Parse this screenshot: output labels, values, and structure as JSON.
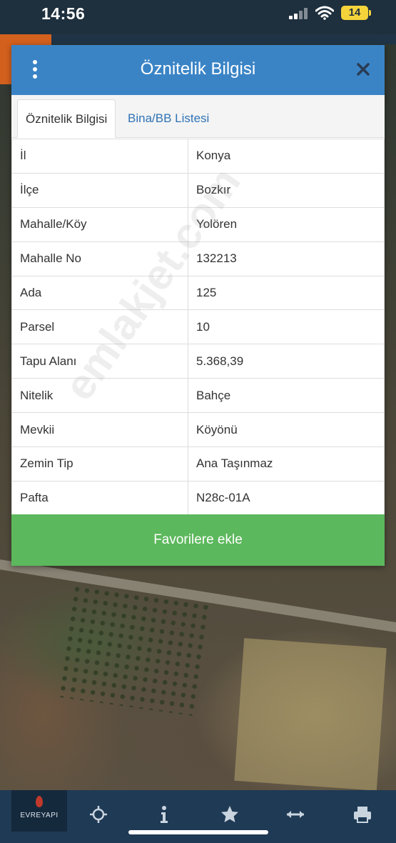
{
  "status_bar": {
    "time": "14:56",
    "battery": "14"
  },
  "dialog": {
    "title": "Öznitelik Bilgisi",
    "tabs": [
      {
        "label": "Öznitelik Bilgisi",
        "active": true
      },
      {
        "label": "Bina/BB Listesi",
        "active": false
      }
    ],
    "rows": [
      {
        "key": "İl",
        "value": "Konya"
      },
      {
        "key": "İlçe",
        "value": "Bozkır"
      },
      {
        "key": "Mahalle/Köy",
        "value": "Yolören"
      },
      {
        "key": "Mahalle No",
        "value": "132213"
      },
      {
        "key": "Ada",
        "value": "125"
      },
      {
        "key": "Parsel",
        "value": "10"
      },
      {
        "key": "Tapu Alanı",
        "value": "5.368,39"
      },
      {
        "key": "Nitelik",
        "value": "Bahçe"
      },
      {
        "key": "Mevkii",
        "value": "Köyönü"
      },
      {
        "key": "Zemin Tip",
        "value": "Ana Taşınmaz"
      },
      {
        "key": "Pafta",
        "value": "N28c-01A"
      }
    ],
    "favorite_button": "Favorilere ekle"
  },
  "watermark": "emlakjet.com",
  "toolbar": {
    "logo_text": "EVREYAPI",
    "icons": [
      "crosshair-icon",
      "info-icon",
      "star-icon",
      "measure-icon",
      "print-icon"
    ]
  },
  "colors": {
    "header": "#3a84c6",
    "button": "#5cb85c",
    "toolbar": "#1f3a55",
    "link": "#2f73b5"
  }
}
